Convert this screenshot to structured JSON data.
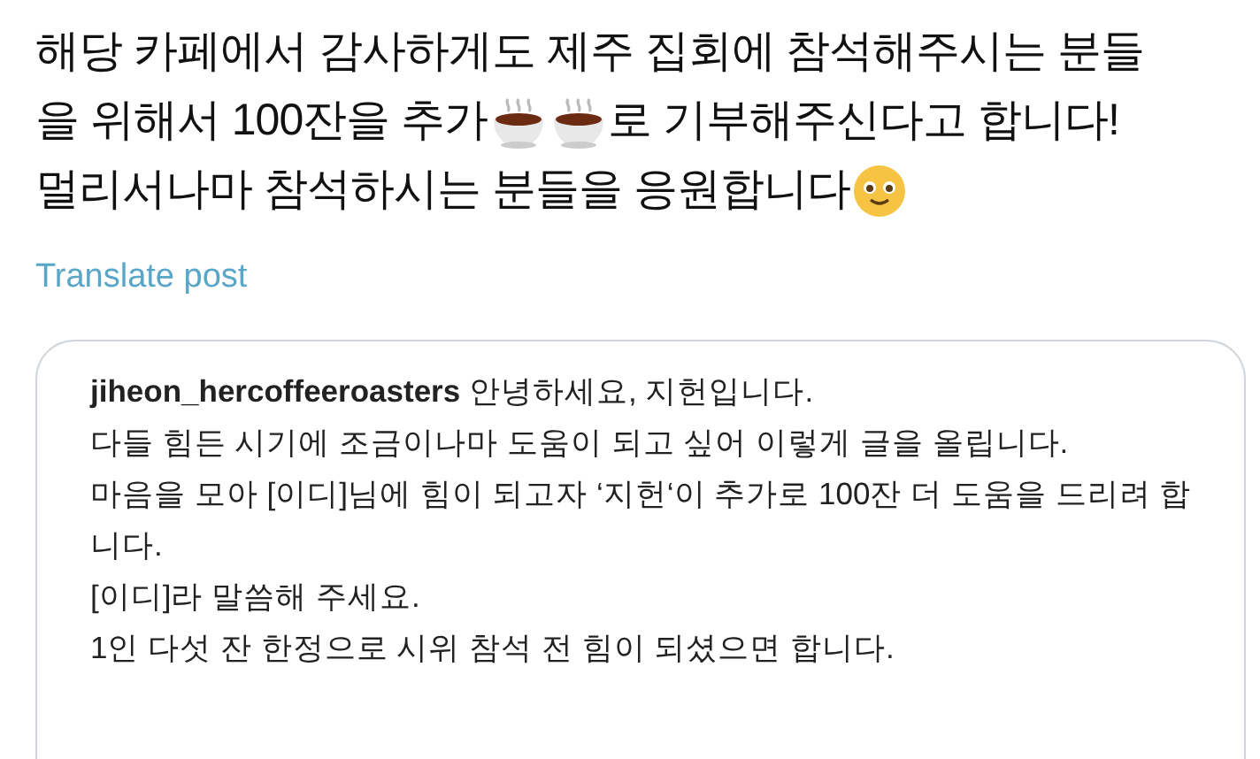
{
  "post": {
    "lines": [
      [
        {
          "kind": "text",
          "text": "해당 카페에서 감사하게도 제주 집회에 참석해주시는 분들"
        }
      ],
      [
        {
          "kind": "text",
          "text": "을 위해서 100잔을 추가"
        },
        {
          "kind": "coffee"
        },
        {
          "kind": "coffee"
        },
        {
          "kind": "text",
          "text": "로 기부해주신다고 합니다!"
        }
      ],
      [
        {
          "kind": "text",
          "text": "멀리서나마 참석하시는 분들을 응원합니다"
        },
        {
          "kind": "face"
        }
      ]
    ],
    "translate_link": "Translate post"
  },
  "quoted": {
    "username": "jiheon_hercoffeeroasters",
    "paragraphs": [
      "안녕하세요, 지헌입니다.",
      "다들 힘든 시기에 조금이나마 도움이 되고 싶어 이렇게 글을 올립니다.",
      "마음을 모아 [이디]님에 힘이 되고자 ‘지헌‘이 추가로 100잔 더 도움을 드리려 합니다.",
      "[이디]라 말씀해 주세요.",
      "1인 다섯 잔 한정으로 시위 참석 전 힘이 되셨으면 합니다."
    ]
  }
}
